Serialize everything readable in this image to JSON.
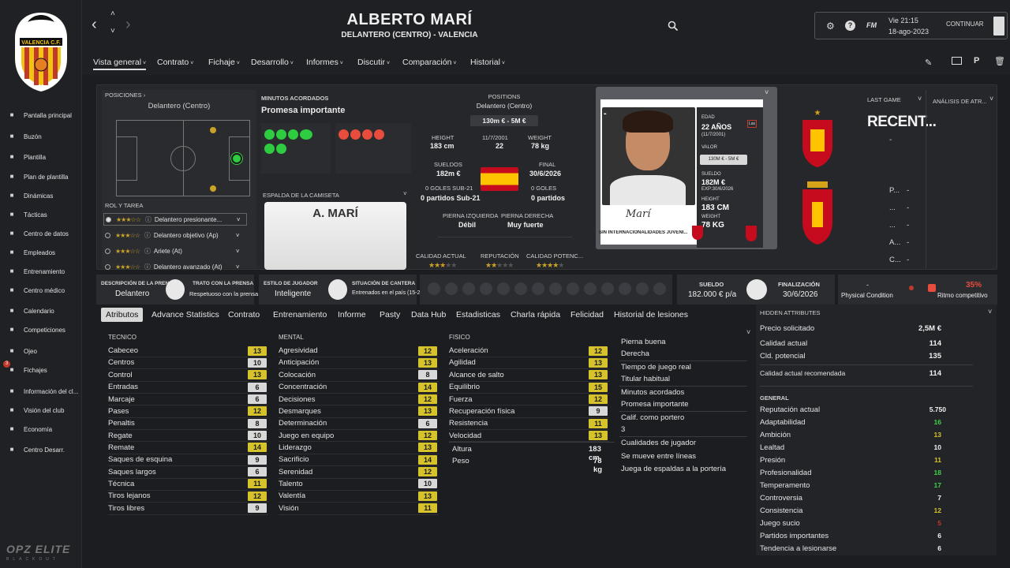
{
  "sidebar": {
    "items": [
      {
        "label": "Pantalla principal",
        "icon": "home-icon"
      },
      {
        "label": "Buzón",
        "icon": "inbox-icon"
      },
      {
        "label": "Plantilla",
        "icon": "shirt-icon"
      },
      {
        "label": "Plan de plantilla",
        "icon": "clipboard-icon"
      },
      {
        "label": "Dinámicas",
        "icon": "dynamics-icon"
      },
      {
        "label": "Tácticas",
        "icon": "tactics-icon"
      },
      {
        "label": "Centro de datos",
        "icon": "data-icon"
      },
      {
        "label": "Empleados",
        "icon": "staff-icon"
      },
      {
        "label": "Entrenamiento",
        "icon": "training-icon"
      },
      {
        "label": "Centro médico",
        "icon": "medical-icon"
      },
      {
        "label": "Calendario",
        "icon": "calendar-icon"
      },
      {
        "label": "Competiciones",
        "icon": "trophy-icon"
      },
      {
        "label": "Ojeo",
        "icon": "scouting-icon"
      },
      {
        "label": "Fichajes",
        "icon": "transfers-icon"
      },
      {
        "label": "Información del cl...",
        "icon": "club-info-icon"
      },
      {
        "label": "Visión del club",
        "icon": "vision-icon"
      },
      {
        "label": "Economía",
        "icon": "finance-icon"
      },
      {
        "label": "Centro Desarr.",
        "icon": "development-icon"
      }
    ],
    "fichajes_badge": "3",
    "crest_text": "VALENCIA C.F.",
    "skin_logo": "OPZ ELITE",
    "skin_sub": "BLACKOUT"
  },
  "header": {
    "name": "ALBERTO MARÍ",
    "subtitle": "DELANTERO (CENTRO) - VALENCIA",
    "fm_label": "FM",
    "day_time": "Vie 21:15",
    "date": "18-ago-2023",
    "continue_label": "CONTINUAR",
    "tabs": [
      "Vista general",
      "Contrato",
      "Fichaje",
      "Desarrollo",
      "Informes",
      "Discutir",
      "Comparación",
      "Historial"
    ]
  },
  "positions_panel": {
    "title": "POSICIONES ›",
    "position": "Delantero (Centro)",
    "role_title": "ROL Y TAREA",
    "roles": [
      {
        "label": "Delantero presionante...",
        "stars": 3,
        "half": false
      },
      {
        "label": "Delantero objetivo (Ap)",
        "stars": 3,
        "half": false
      },
      {
        "label": "Ariete (At)",
        "stars": 2,
        "half": true
      },
      {
        "label": "Delantero avanzado (At)",
        "stars": 2,
        "half": true
      }
    ]
  },
  "minutes_panel": {
    "title": "MINUTOS ACORDADOS",
    "value": "Promesa importante",
    "shirt_title": "ESPALDA DE LA CAMISETA",
    "shirt_name": "A. MARÍ"
  },
  "info_panel": {
    "positions_label": "POSITIONS",
    "positions_value": "Delantero (Centro)",
    "value_range": "130m € - 5M €",
    "height_label": "HEIGHT",
    "height": "183 cm",
    "dob": "11/7/2001",
    "age": "22",
    "weight_label": "WEIGHT",
    "weight": "78 kg",
    "wages_label": "SUELDOS",
    "wages": "182m €",
    "final_label": "FINAL",
    "final": "30/6/2026",
    "u21_goals": "0 GOLES SUB-21",
    "u21_matches": "0 partidos Sub-21",
    "goals": "0 GOLES",
    "matches": "0 partidos",
    "left_foot_label": "PIERNA IZQUIERDA",
    "left_foot": "Débil",
    "right_foot_label": "PIERNA DERECHA",
    "right_foot": "Muy fuerte",
    "ca_label": "CALIDAD ACTUAL",
    "rep_label": "REPUTACIÓN",
    "pa_label": "CALIDAD POTENC..."
  },
  "card": {
    "edad_label": "EDAD",
    "edad": "22 AÑOS",
    "dob": "(11/7/2001)",
    "valor_label": "VALOR",
    "valor": "130M € - 5M €",
    "sueldo_label": "SUELDO",
    "sueldo": "182M €",
    "exp": "EXP:30/6/2026",
    "height_label": "HEIGHT",
    "height": "183 CM",
    "weight_label": "WEIGHT",
    "weight": "78 KG",
    "signature": "Marí",
    "caption": "SIN INTERNACIONALIDADES JUVENI...",
    "dash": "-",
    "league_badge": "Las"
  },
  "last_game": {
    "title": "LAST GAME",
    "value": "RECENT...",
    "dash": "-",
    "rows": [
      "P...",
      "...",
      "...",
      "A...",
      "C..."
    ],
    "analysis": "ANÁLISIS DE ATR..."
  },
  "status_bar": {
    "press_desc_label": "DESCRIPCIÓN DE LA PRENSA",
    "press_desc": "Delantero",
    "press_treat_label": "TRATO CON LA PRENSA",
    "press_treat": "Respetuoso con la prensa",
    "style_label": "ESTILO DE JUGADOR",
    "style": "Inteligente",
    "youth_label": "SITUACIÓN DE CANTERA",
    "youth": "Entrenados en el país (15-21)",
    "wage_label": "SUELDO",
    "wage": "182.000 € p/a",
    "end_label": "FINALIZACIÓN",
    "end": "30/6/2026",
    "physical_label": "Physical Condition",
    "physical_dash": "-",
    "rhythm_label": "Ritmo competitivo",
    "rhythm": "35%"
  },
  "subtabs": [
    "Atributos",
    "Advance Statistics",
    "Contrato",
    "Entrenamiento",
    "Informe",
    "Pasty",
    "Data Hub",
    "Estadisticas",
    "Charla rápida",
    "Felicidad",
    "Historial de lesiones"
  ],
  "attributes": {
    "tecnico_label": "TECNICO",
    "tecnico": [
      {
        "n": "Cabeceo",
        "v": "13",
        "c": "y"
      },
      {
        "n": "Centros",
        "v": "10",
        "c": "w"
      },
      {
        "n": "Control",
        "v": "13",
        "c": "y"
      },
      {
        "n": "Entradas",
        "v": "6",
        "c": "w"
      },
      {
        "n": "Marcaje",
        "v": "6",
        "c": "w"
      },
      {
        "n": "Pases",
        "v": "12",
        "c": "y"
      },
      {
        "n": "Penaltis",
        "v": "8",
        "c": "w"
      },
      {
        "n": "Regate",
        "v": "10",
        "c": "w"
      },
      {
        "n": "Remate",
        "v": "14",
        "c": "y"
      },
      {
        "n": "Saques de esquina",
        "v": "9",
        "c": "w"
      },
      {
        "n": "Saques largos",
        "v": "6",
        "c": "w"
      },
      {
        "n": "Técnica",
        "v": "11",
        "c": "y"
      },
      {
        "n": "Tiros lejanos",
        "v": "12",
        "c": "y"
      },
      {
        "n": "Tiros libres",
        "v": "9",
        "c": "w"
      }
    ],
    "mental_label": "MENTAL",
    "mental": [
      {
        "n": "Agresividad",
        "v": "12",
        "c": "y"
      },
      {
        "n": "Anticipación",
        "v": "13",
        "c": "y"
      },
      {
        "n": "Colocación",
        "v": "8",
        "c": "w"
      },
      {
        "n": "Concentración",
        "v": "14",
        "c": "y"
      },
      {
        "n": "Decisiones",
        "v": "12",
        "c": "y"
      },
      {
        "n": "Desmarques",
        "v": "13",
        "c": "y"
      },
      {
        "n": "Determinación",
        "v": "6",
        "c": "w"
      },
      {
        "n": "Juego en equipo",
        "v": "12",
        "c": "y"
      },
      {
        "n": "Liderazgo",
        "v": "13",
        "c": "y"
      },
      {
        "n": "Sacrificio",
        "v": "14",
        "c": "y"
      },
      {
        "n": "Serenidad",
        "v": "12",
        "c": "y"
      },
      {
        "n": "Talento",
        "v": "10",
        "c": "w"
      },
      {
        "n": "Valentía",
        "v": "13",
        "c": "y"
      },
      {
        "n": "Visión",
        "v": "11",
        "c": "y"
      }
    ],
    "fisico_label": "FISICO",
    "fisico": [
      {
        "n": "Aceleración",
        "v": "12",
        "c": "y"
      },
      {
        "n": "Agilidad",
        "v": "13",
        "c": "y"
      },
      {
        "n": "Alcance de salto",
        "v": "13",
        "c": "y"
      },
      {
        "n": "Equilibrio",
        "v": "15",
        "c": "y"
      },
      {
        "n": "Fuerza",
        "v": "12",
        "c": "y"
      },
      {
        "n": "Recuperación física",
        "v": "9",
        "c": "w"
      },
      {
        "n": "Resistencia",
        "v": "11",
        "c": "y"
      },
      {
        "n": "Velocidad",
        "v": "13",
        "c": "y"
      }
    ],
    "altura_label": "Altura",
    "altura": "183 cm",
    "peso_label": "Peso",
    "peso": "78 kg"
  },
  "misc": {
    "foot_label": "Pierna buena",
    "foot": "Derecha",
    "status_label": "Tiempo de juego real",
    "status": "Titular habitual",
    "minutes_label": "Minutos acordados",
    "minutes": "Promesa importante",
    "gk_label": "Calif. como portero",
    "gk": "3",
    "traits_label": "Cualidades de jugador",
    "traits": [
      "Se mueve entre líneas",
      "Juega de espaldas a la portería"
    ]
  },
  "hidden": {
    "title": "HIDDEN ATTRIBUTES",
    "top": [
      {
        "n": "Precio solicitado",
        "v": "2,5M €",
        "col": "#f0f0f0"
      },
      {
        "n": "Calidad actual",
        "v": "114",
        "col": "#f0f0f0"
      },
      {
        "n": "Cld. potencial",
        "v": "135",
        "col": "#f0f0f0"
      },
      {
        "n": "Calidad actual recomendada",
        "v": "114",
        "col": "#f0f0f0"
      }
    ],
    "general_label": "GENERAL",
    "general": [
      {
        "n": "Reputación actual",
        "v": "5.750",
        "col": "#f0f0f0"
      },
      {
        "n": "Adaptabilidad",
        "v": "16",
        "col": "#3fd14a"
      },
      {
        "n": "Ambición",
        "v": "13",
        "col": "#d6c22a"
      },
      {
        "n": "Lealtad",
        "v": "10",
        "col": "#f0f0f0"
      },
      {
        "n": "Presión",
        "v": "11",
        "col": "#d6c22a"
      },
      {
        "n": "Profesionalidad",
        "v": "18",
        "col": "#3fd14a"
      },
      {
        "n": "Temperamento",
        "v": "17",
        "col": "#3fd14a"
      },
      {
        "n": "Controversia",
        "v": "7",
        "col": "#f0f0f0"
      },
      {
        "n": "Consistencia",
        "v": "12",
        "col": "#d6c22a"
      },
      {
        "n": "Juego sucio",
        "v": "5",
        "col": "#c0392b"
      },
      {
        "n": "Partidos importantes",
        "v": "6",
        "col": "#f0f0f0"
      },
      {
        "n": "Tendencia a lesionarse",
        "v": "6",
        "col": "#f0f0f0"
      }
    ]
  },
  "colors": {
    "accent_yellow": "#d6c22a",
    "good_green": "#3fd14a",
    "bad_red": "#c0392b"
  }
}
